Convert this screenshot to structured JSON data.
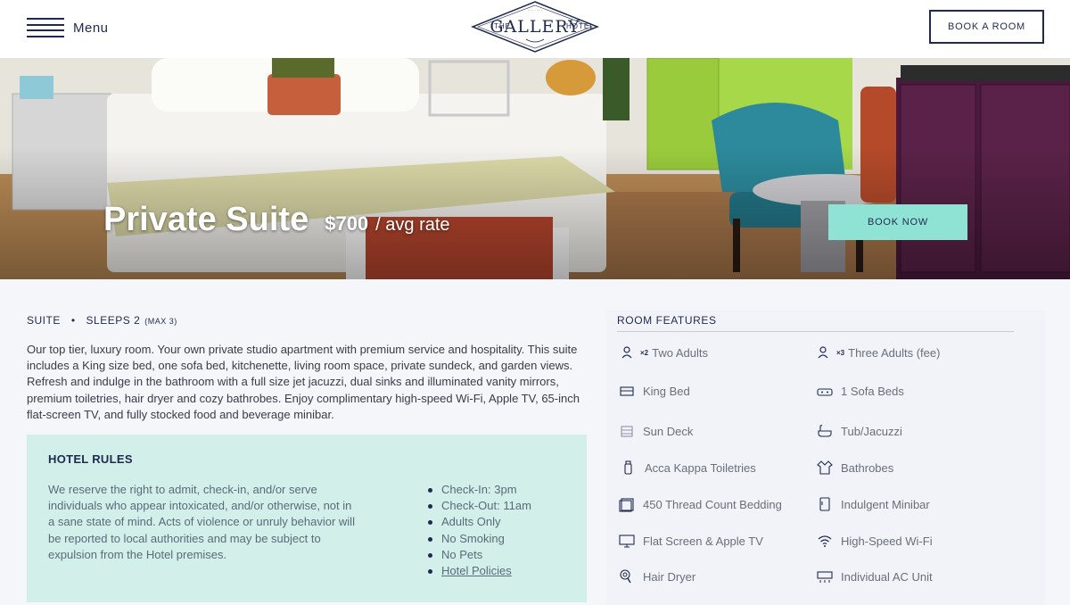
{
  "header": {
    "menu_label": "Menu",
    "logo": {
      "the": "THE",
      "main": "GALLERY",
      "hotel": "HOTEL"
    },
    "book_room_label": "BOOK A ROOM"
  },
  "hero": {
    "title": "Private Suite",
    "price": "$700",
    "price_suffix": "/ avg rate",
    "book_now_label": "BOOK NOW"
  },
  "room": {
    "type": "SUITE",
    "sleeps": "SLEEPS 2",
    "max": "(MAX 3)",
    "description": "Our top tier, luxury room. Your own private studio apartment with premium service and hospitality. This suite includes a King size bed, one sofa bed, kitchenette, living room space, private sundeck, and garden views. Refresh and indulge in the bathroom with a full size jet jacuzzi, dual sinks and illuminated vanity mirrors, premium toiletries, hair dryer and cozy bathrobes. Enjoy complimentary high-speed Wi-Fi, Apple TV, 65-inch flat-screen TV, and fully stocked food and beverage minibar."
  },
  "rules": {
    "title": "HOTEL RULES",
    "text": "We reserve the right to admit, check-in, and/or serve individuals who appear intoxicated, and/or otherwise, not in a sane state of mind. Acts of violence or unruly behavior will be reported to local authorities and may be subject to expulsion from the Hotel premises.",
    "items": [
      "Check-In: 3pm",
      "Check-Out: 11am",
      "Adults Only",
      "No Smoking",
      "No Pets"
    ],
    "policies_link": "Hotel Policies"
  },
  "features": {
    "title": "ROOM FEATURES",
    "items": [
      {
        "label": "Two Adults",
        "icon": "person-icon",
        "count": "×2"
      },
      {
        "label": "Three Adults (fee)",
        "icon": "person-icon",
        "count": "×3"
      },
      {
        "label": "King Bed",
        "icon": "bed-icon"
      },
      {
        "label": "1 Sofa Beds",
        "icon": "sofa-icon"
      },
      {
        "label": "Sun Deck",
        "icon": "deck-icon"
      },
      {
        "label": "Tub/Jacuzzi",
        "icon": "bathtub-icon"
      },
      {
        "label": "Acca Kappa Toiletries",
        "icon": "bottle-icon"
      },
      {
        "label": "Bathrobes",
        "icon": "robe-icon"
      },
      {
        "label": "450 Thread Count Bedding",
        "icon": "bedding-icon"
      },
      {
        "label": "Indulgent Minibar",
        "icon": "minibar-icon"
      },
      {
        "label": "Flat Screen & Apple TV",
        "icon": "tv-icon"
      },
      {
        "label": "High-Speed Wi-Fi",
        "icon": "wifi-icon"
      },
      {
        "label": "Hair Dryer",
        "icon": "hair-dryer-icon"
      },
      {
        "label": "Individual AC Unit",
        "icon": "ac-unit-icon"
      }
    ]
  },
  "colors": {
    "navy": "#1f2a4f",
    "mint_button": "#8fe3d5",
    "rules_bg": "#d3efea"
  }
}
